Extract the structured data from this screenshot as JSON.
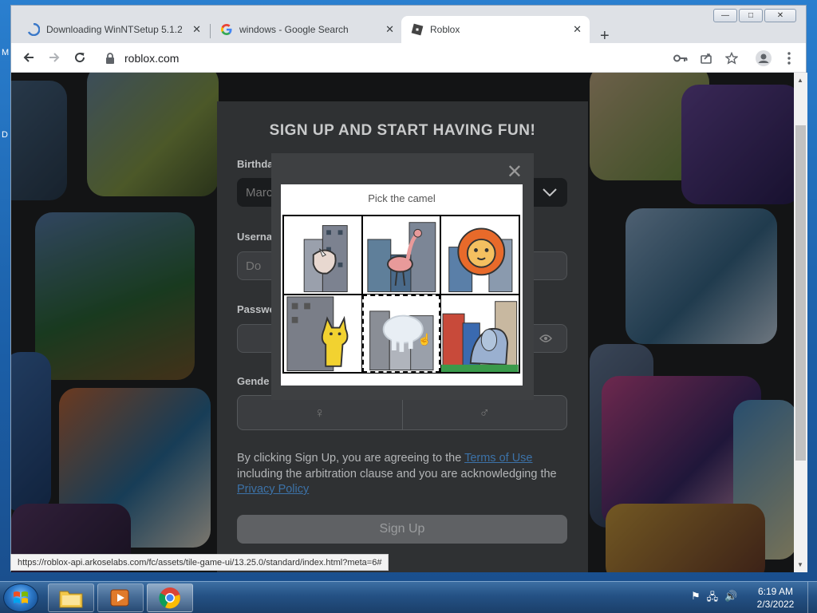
{
  "desktop": {
    "side_letters": [
      "M",
      "D"
    ]
  },
  "browser": {
    "window_controls": {
      "minimize": "—",
      "maximize": "□",
      "close": "✕"
    },
    "tabs": [
      {
        "label": "Downloading WinNTSetup 5.1.2",
        "icon": "download-favicon-icon"
      },
      {
        "label": "windows - Google Search",
        "icon": "google-favicon-icon"
      },
      {
        "label": "Roblox",
        "icon": "roblox-favicon-icon",
        "active": true
      }
    ],
    "new_tab": "+",
    "url": "roblox.com",
    "status_url": "https://roblox-api.arkoselabs.com/fc/assets/tile-game-ui/13.25.0/standard/index.html?meta=6#"
  },
  "signup": {
    "title": "SIGN UP AND START HAVING FUN!",
    "birthday_label": "Birthda",
    "birthday_value": "Marc",
    "username_label": "Userna",
    "username_placeholder": "Do",
    "password_label": "Passwo",
    "gender_label": "Gende",
    "terms_before": "By clicking Sign Up, you are agreeing to the ",
    "terms_link": "Terms of Use",
    "terms_middle": " including the arbitration clause and you are acknowledging the ",
    "privacy_link": "Privacy Policy",
    "signup_button": "Sign Up"
  },
  "captcha": {
    "instruction": "Pick the camel",
    "tiles": [
      {
        "animal": "rhino"
      },
      {
        "animal": "ostrich"
      },
      {
        "animal": "lion"
      },
      {
        "animal": "cat"
      },
      {
        "animal": "elephant",
        "selected": true
      },
      {
        "animal": "elephant"
      }
    ]
  },
  "taskbar": {
    "clock_time": "6:19 AM",
    "clock_date": "2/3/2022"
  }
}
